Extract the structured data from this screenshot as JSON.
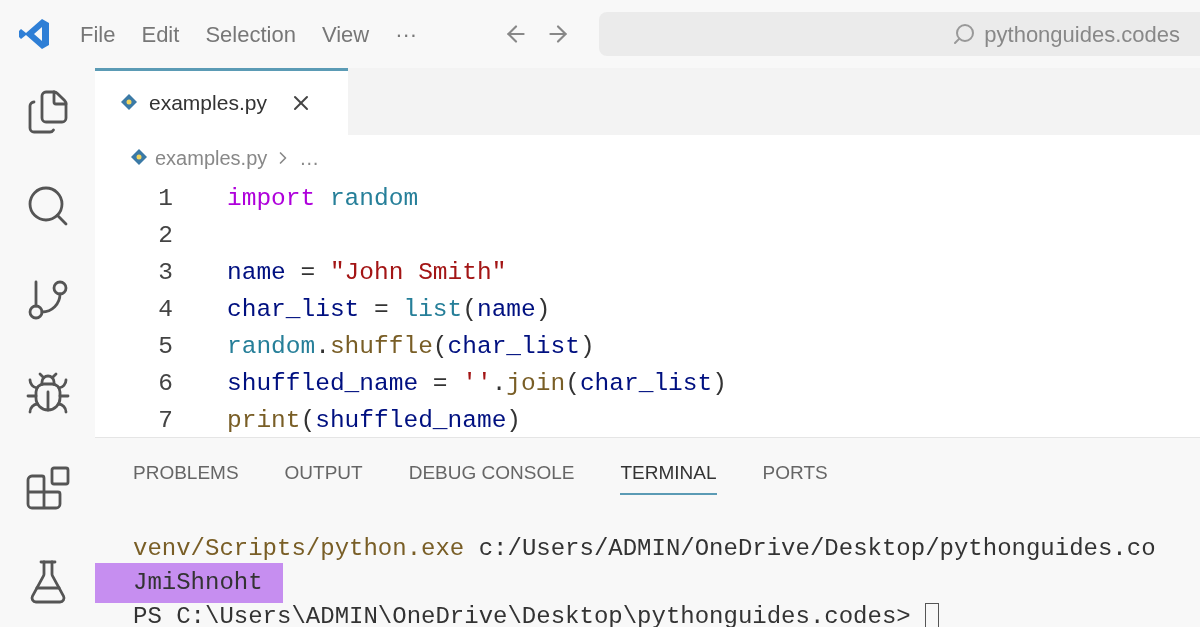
{
  "menu": [
    "File",
    "Edit",
    "Selection",
    "View",
    "···"
  ],
  "search": {
    "value": "pythonguides.codes"
  },
  "activity_bar": [
    {
      "kind": "files",
      "selected": false
    },
    {
      "kind": "search",
      "selected": false
    },
    {
      "kind": "source-control",
      "selected": false
    },
    {
      "kind": "run-debug",
      "selected": false
    },
    {
      "kind": "extensions",
      "selected": false
    },
    {
      "kind": "testing",
      "selected": false
    }
  ],
  "editor_tabs": [
    {
      "label": "examples.py",
      "selected": true
    }
  ],
  "breadcrumb": [
    "examples.py",
    "…"
  ],
  "code": [
    {
      "number": "1",
      "tokens": [
        {
          "kind": "keyword",
          "text": "import "
        },
        {
          "kind": "module",
          "text": "random"
        }
      ]
    },
    {
      "number": "2"
    },
    {
      "number": "3",
      "tokens": [
        {
          "kind": "variable",
          "text": "name"
        },
        {
          "kind": "plain",
          "text": " = "
        },
        {
          "kind": "string",
          "text": "\"John Smith\""
        }
      ]
    },
    {
      "number": "4",
      "tokens": [
        {
          "kind": "variable",
          "text": "char_list"
        },
        {
          "kind": "plain",
          "text": " = "
        },
        {
          "kind": "module",
          "text": "list"
        },
        {
          "kind": "plain",
          "text": "("
        },
        {
          "kind": "variable",
          "text": "name"
        },
        {
          "kind": "plain",
          "text": ")"
        }
      ]
    },
    {
      "number": "5",
      "tokens": [
        {
          "kind": "module",
          "text": "random"
        },
        {
          "kind": "plain",
          "text": "."
        },
        {
          "kind": "function",
          "text": "shuffle"
        },
        {
          "kind": "plain",
          "text": "("
        },
        {
          "kind": "variable",
          "text": "char_list"
        },
        {
          "kind": "plain",
          "text": ")"
        }
      ]
    },
    {
      "number": "6",
      "tokens": [
        {
          "kind": "variable",
          "text": "shuffled_name"
        },
        {
          "kind": "plain",
          "text": " = "
        },
        {
          "kind": "string",
          "text": "''"
        },
        {
          "kind": "plain",
          "text": "."
        },
        {
          "kind": "function",
          "text": "join"
        },
        {
          "kind": "plain",
          "text": "("
        },
        {
          "kind": "variable",
          "text": "char_list"
        },
        {
          "kind": "plain",
          "text": ")"
        }
      ]
    },
    {
      "number": "7",
      "tokens": [
        {
          "kind": "function",
          "text": "print"
        },
        {
          "kind": "plain",
          "text": "("
        },
        {
          "kind": "variable",
          "text": "shuffled_name"
        },
        {
          "kind": "plain",
          "text": ")"
        }
      ]
    }
  ],
  "panel_tabs": [
    {
      "label": "PROBLEMS",
      "selected": false
    },
    {
      "label": "OUTPUT",
      "selected": false
    },
    {
      "label": "DEBUG CONSOLE",
      "selected": false
    },
    {
      "label": "TERMINAL",
      "selected": true
    },
    {
      "label": "PORTS",
      "selected": false
    }
  ],
  "terminal": [
    {
      "kind": "command",
      "parts": [
        {
          "kind": "function",
          "text": "venv/Scripts/python.exe"
        },
        {
          "kind": "plain",
          "text": " c:/Users/ADMIN/OneDrive/Desktop/pythonguides.co"
        }
      ]
    },
    {
      "kind": "highlighted",
      "parts": [
        {
          "kind": "plain",
          "text": "JmiShnoht"
        }
      ]
    },
    {
      "kind": "prompt",
      "parts": [
        {
          "kind": "plain",
          "text": "PS C:\\Users\\ADMIN\\OneDrive\\Desktop\\pythonguides.codes>"
        }
      ]
    }
  ]
}
